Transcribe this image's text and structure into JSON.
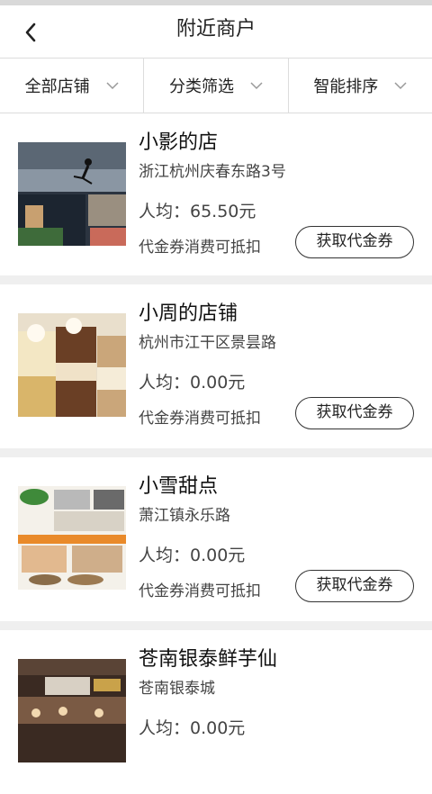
{
  "header": {
    "title": "附近商户"
  },
  "filters": [
    {
      "label": "全部店铺"
    },
    {
      "label": "分类筛选"
    },
    {
      "label": "智能排序"
    }
  ],
  "shops": [
    {
      "name": "小影的店",
      "address": "浙江杭州庆春东路3号",
      "avg_price": "人均：65.50元",
      "voucher_note": "代金券消费可抵扣",
      "button": "获取代金券"
    },
    {
      "name": "小周的店铺",
      "address": "杭州市江干区景昙路",
      "avg_price": "人均：0.00元",
      "voucher_note": "代金券消费可抵扣",
      "button": "获取代金券"
    },
    {
      "name": "小雪甜点",
      "address": "萧江镇永乐路",
      "avg_price": "人均：0.00元",
      "voucher_note": "代金券消费可抵扣",
      "button": "获取代金券"
    },
    {
      "name": "苍南银泰鲜芋仙",
      "address": "苍南银泰城",
      "avg_price": "人均：0.00元",
      "voucher_note": "",
      "button": ""
    }
  ],
  "icons": {
    "back": "back-arrow-icon",
    "dropdown": "chevron-down-icon"
  }
}
